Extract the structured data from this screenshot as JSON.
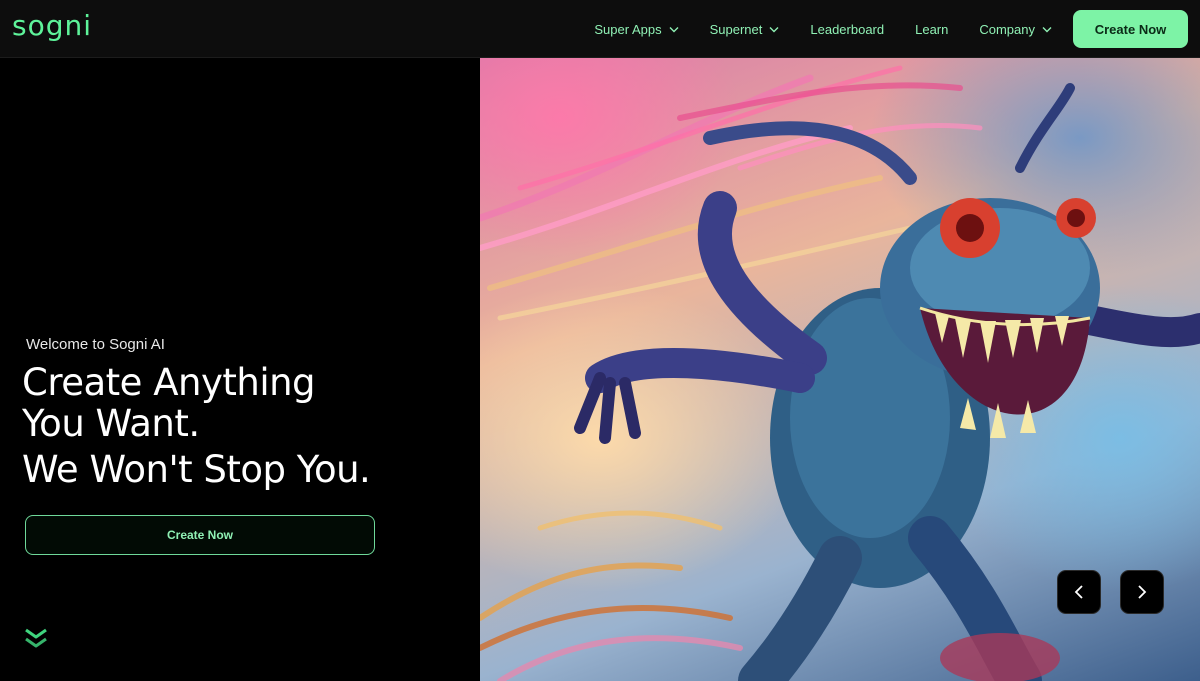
{
  "brand": {
    "logo_text": "sogni",
    "accent": "#5ef39a"
  },
  "nav": {
    "items": [
      {
        "label": "Super Apps",
        "dropdown": true
      },
      {
        "label": "Supernet",
        "dropdown": true
      },
      {
        "label": "Leaderboard",
        "dropdown": false
      },
      {
        "label": "Learn",
        "dropdown": false
      },
      {
        "label": "Company",
        "dropdown": true
      }
    ],
    "cta_label": "Create Now"
  },
  "hero": {
    "welcome": "Welcome to Sogni AI",
    "headline_line1": "Create Anything",
    "headline_line2": "You Want.",
    "headline_line3": "We Won't Stop You.",
    "cta_label": "Create Now",
    "scroll_icon": "double-chevron-down-icon",
    "image_subject": "creature-artwork",
    "prev_icon": "chevron-left-icon",
    "next_icon": "chevron-right-icon"
  }
}
